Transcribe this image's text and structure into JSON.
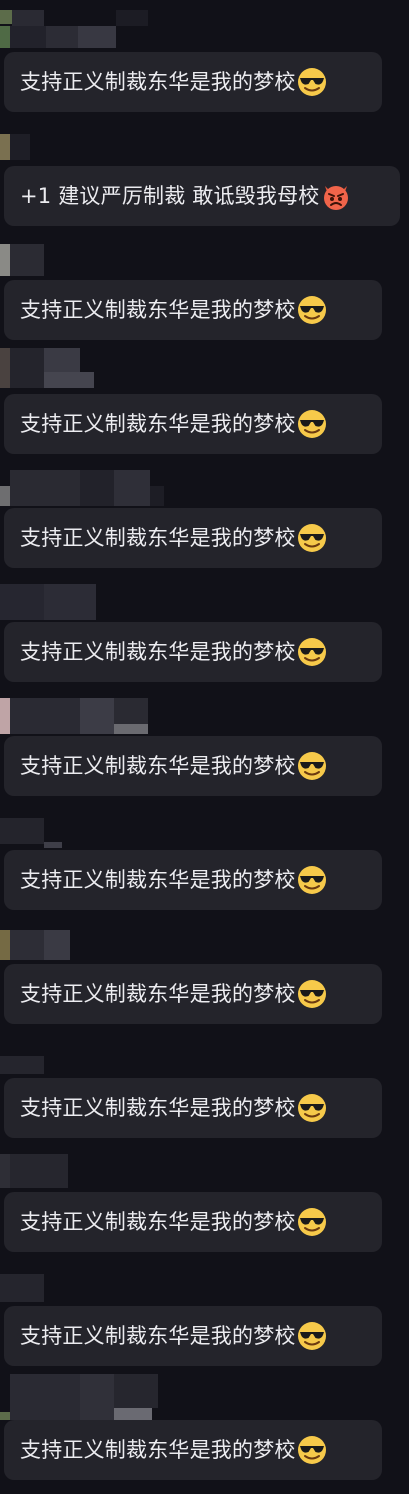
{
  "chat": {
    "messages": [
      {
        "text": "支持正义制裁东华是我的梦校",
        "emoji": "sunglasses-smile-emoji",
        "bubble_color": "#24242b"
      },
      {
        "text": "+1 建议严厉制裁 敢诋毁我母校",
        "emoji": "angry-devil-emoji",
        "bubble_color": "#24242b"
      },
      {
        "text": "支持正义制裁东华是我的梦校",
        "emoji": "sunglasses-smile-emoji",
        "bubble_color": "#24242b"
      },
      {
        "text": "支持正义制裁东华是我的梦校",
        "emoji": "sunglasses-smile-emoji",
        "bubble_color": "#24242b"
      },
      {
        "text": "支持正义制裁东华是我的梦校",
        "emoji": "sunglasses-smile-emoji",
        "bubble_color": "#24242b"
      },
      {
        "text": "支持正义制裁东华是我的梦校",
        "emoji": "sunglasses-smile-emoji",
        "bubble_color": "#24242b"
      },
      {
        "text": "支持正义制裁东华是我的梦校",
        "emoji": "sunglasses-smile-emoji",
        "bubble_color": "#24242b"
      },
      {
        "text": "支持正义制裁东华是我的梦校",
        "emoji": "sunglasses-smile-emoji",
        "bubble_color": "#24242b"
      },
      {
        "text": "支持正义制裁东华是我的梦校",
        "emoji": "sunglasses-smile-emoji",
        "bubble_color": "#24242b"
      },
      {
        "text": "支持正义制裁东华是我的梦校",
        "emoji": "sunglasses-smile-emoji",
        "bubble_color": "#24242b"
      },
      {
        "text": "支持正义制裁东华是我的梦校",
        "emoji": "sunglasses-smile-emoji",
        "bubble_color": "#24242b"
      },
      {
        "text": "支持正义制裁东华是我的梦校",
        "emoji": "sunglasses-smile-emoji",
        "bubble_color": "#24242b"
      },
      {
        "text": "支持正义制裁东华是我的梦校",
        "emoji": "sunglasses-smile-emoji",
        "bubble_color": "#24242b"
      }
    ]
  },
  "theme": {
    "background": "#111118",
    "bubble": "#24242b",
    "text": "#ececf0"
  }
}
